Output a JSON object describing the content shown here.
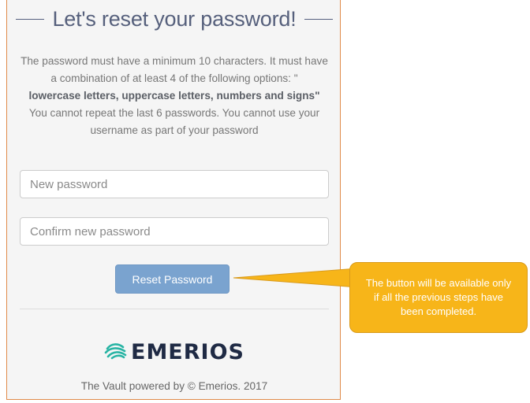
{
  "header": {
    "title": "Let's reset your password!"
  },
  "instructions": {
    "text_1": "The password must have a minimum 10 characters. It must have a combination of at least 4 of the following options: \"",
    "bold": "lowercase letters, uppercase letters, numbers and signs\"",
    "text_2": "You cannot repeat the last 6 passwords. You cannot use your username as part of your password"
  },
  "form": {
    "new_password_placeholder": "New password",
    "confirm_password_placeholder": "Confirm new password",
    "reset_button_label": "Reset Password"
  },
  "logo": {
    "text": "EMERIOS",
    "icon": "emerios-swirl-icon"
  },
  "footer": {
    "text": "The Vault powered by © Emerios. 2017"
  },
  "callout": {
    "text": "The button will be available only if all the previous steps have been completed."
  },
  "colors": {
    "panel_border": "#e08a4a",
    "button_bg": "#7aa3cf",
    "callout_bg": "#f7b519",
    "title_color": "#56607c"
  }
}
